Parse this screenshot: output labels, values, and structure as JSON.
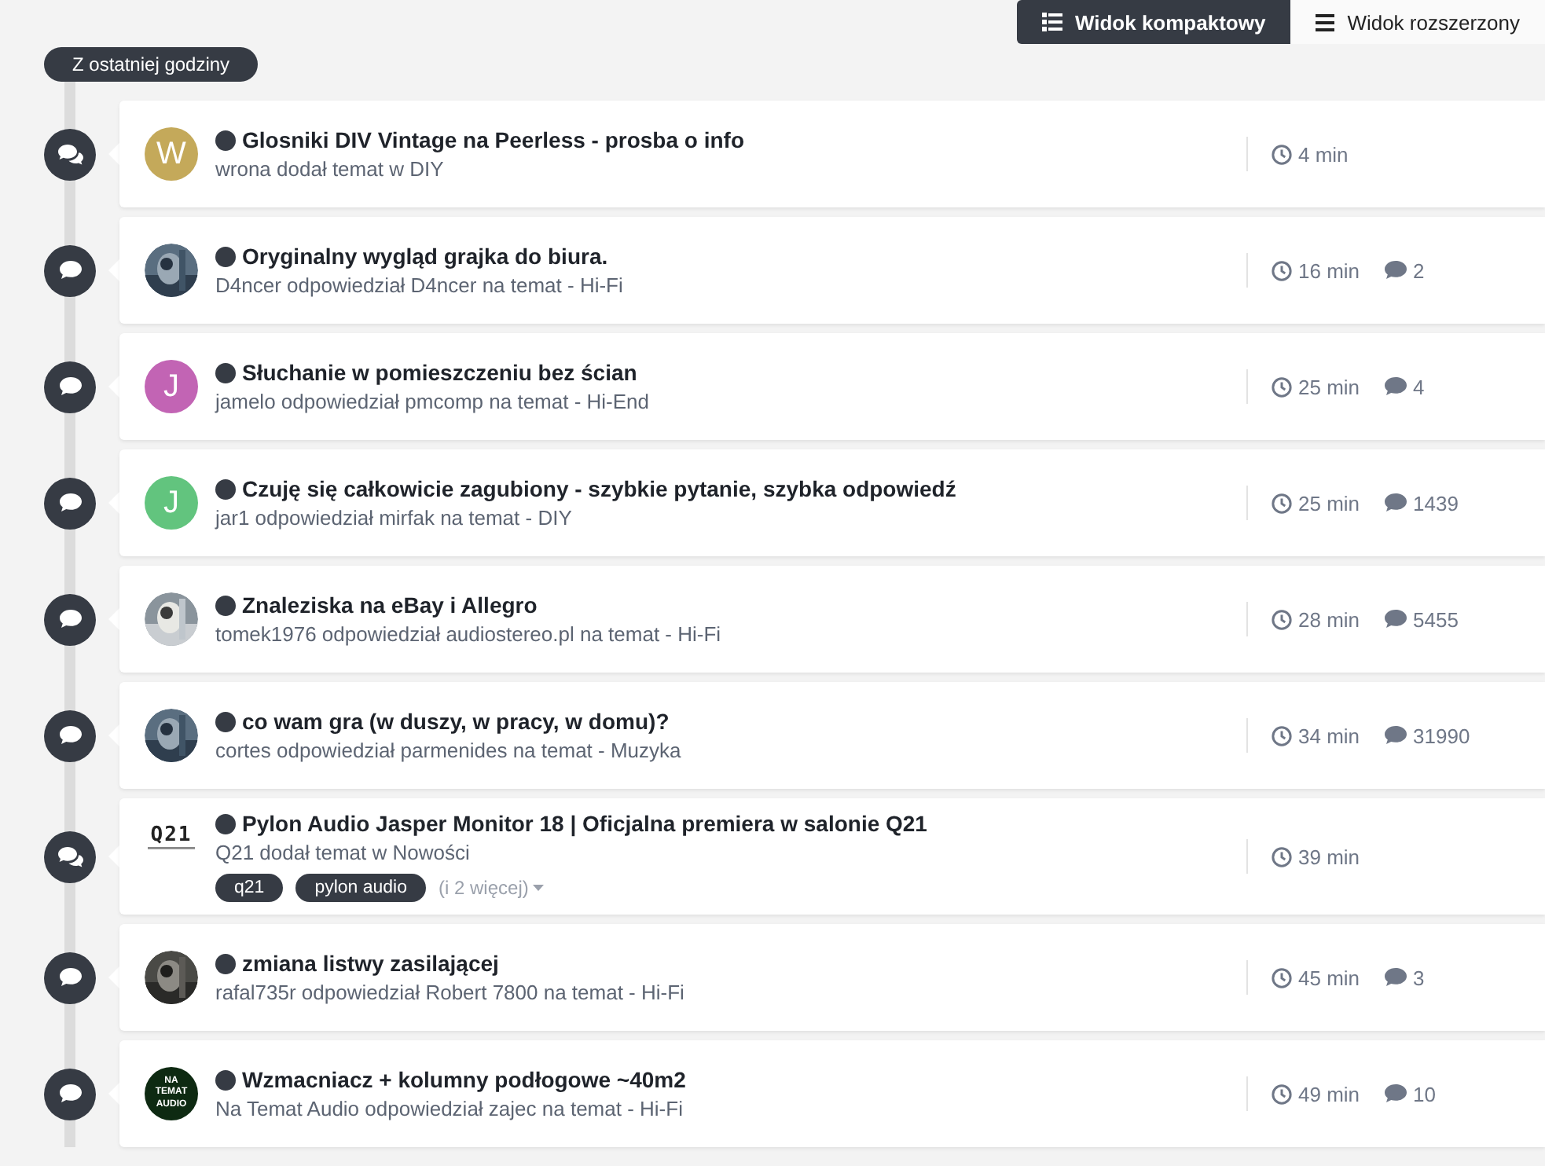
{
  "view_toggle": [
    {
      "label": "Widok kompaktowy",
      "selected": true
    },
    {
      "label": "Widok rozszerzony",
      "selected": false
    }
  ],
  "section_label": "Z ostatniej godziny",
  "activities": [
    {
      "kind": "new_topic",
      "avatar": {
        "kind": "letter",
        "letter": "W",
        "color": "#c4a95a"
      },
      "title": "Glosniki DIV Vintage na Peerless - prosba o info",
      "byline": "wrona dodał temat w DIY",
      "time": "4 min"
    },
    {
      "kind": "reply",
      "title": "Oryginalny wygląd grajka do biura.",
      "byline": "D4ncer odpowiedział D4ncer na temat - Hi-Fi",
      "time": "16 min",
      "replies": "2"
    },
    {
      "kind": "reply",
      "avatar": {
        "kind": "letter",
        "letter": "J",
        "color": "#c264b4"
      },
      "title": "Słuchanie w pomieszczeniu bez ścian",
      "byline": "jamelo odpowiedział pmcomp na temat - Hi-End",
      "time": "25 min",
      "replies": "4"
    },
    {
      "kind": "reply",
      "avatar": {
        "kind": "letter",
        "letter": "J",
        "color": "#62c47e"
      },
      "title": "Czuję się całkowicie zagubiony - szybkie pytanie, szybka odpowiedź",
      "byline": "jar1 odpowiedział mirfak na temat - DIY",
      "time": "25 min",
      "replies": "1439"
    },
    {
      "kind": "reply",
      "title": "Znaleziska na eBay i Allegro",
      "byline": "tomek1976 odpowiedział audiostereo.pl na temat - Hi-Fi",
      "time": "28 min",
      "replies": "5455"
    },
    {
      "kind": "reply",
      "title": "co wam gra (w duszy, w pracy, w domu)?",
      "byline": "cortes odpowiedział parmenides na temat - Muzyka",
      "time": "34 min",
      "replies": "31990"
    },
    {
      "kind": "new_topic",
      "avatar": {
        "kind": "logo",
        "text": "Q21"
      },
      "title": "Pylon Audio Jasper Monitor 18 | Oficjalna premiera w salonie Q21",
      "byline": "Q21 dodał temat w Nowości",
      "tags": [
        "q21",
        "pylon audio"
      ],
      "more_tags": "(i 2 więcej)",
      "time": "39 min"
    },
    {
      "kind": "reply",
      "title": "zmiana listwy zasilającej",
      "byline": "rafal735r odpowiedział Robert 7800 na temat - Hi-Fi",
      "time": "45 min",
      "replies": "3"
    },
    {
      "kind": "reply",
      "avatar": {
        "kind": "badge",
        "lines": [
          "NA",
          "TEMAT",
          "AUDIO"
        ]
      },
      "title": "Wzmacniacz + kolumny podłogowe ~40m2",
      "byline": "Na Temat Audio odpowiedział zajec na temat - Hi-Fi",
      "time": "49 min",
      "replies": "10"
    }
  ]
}
